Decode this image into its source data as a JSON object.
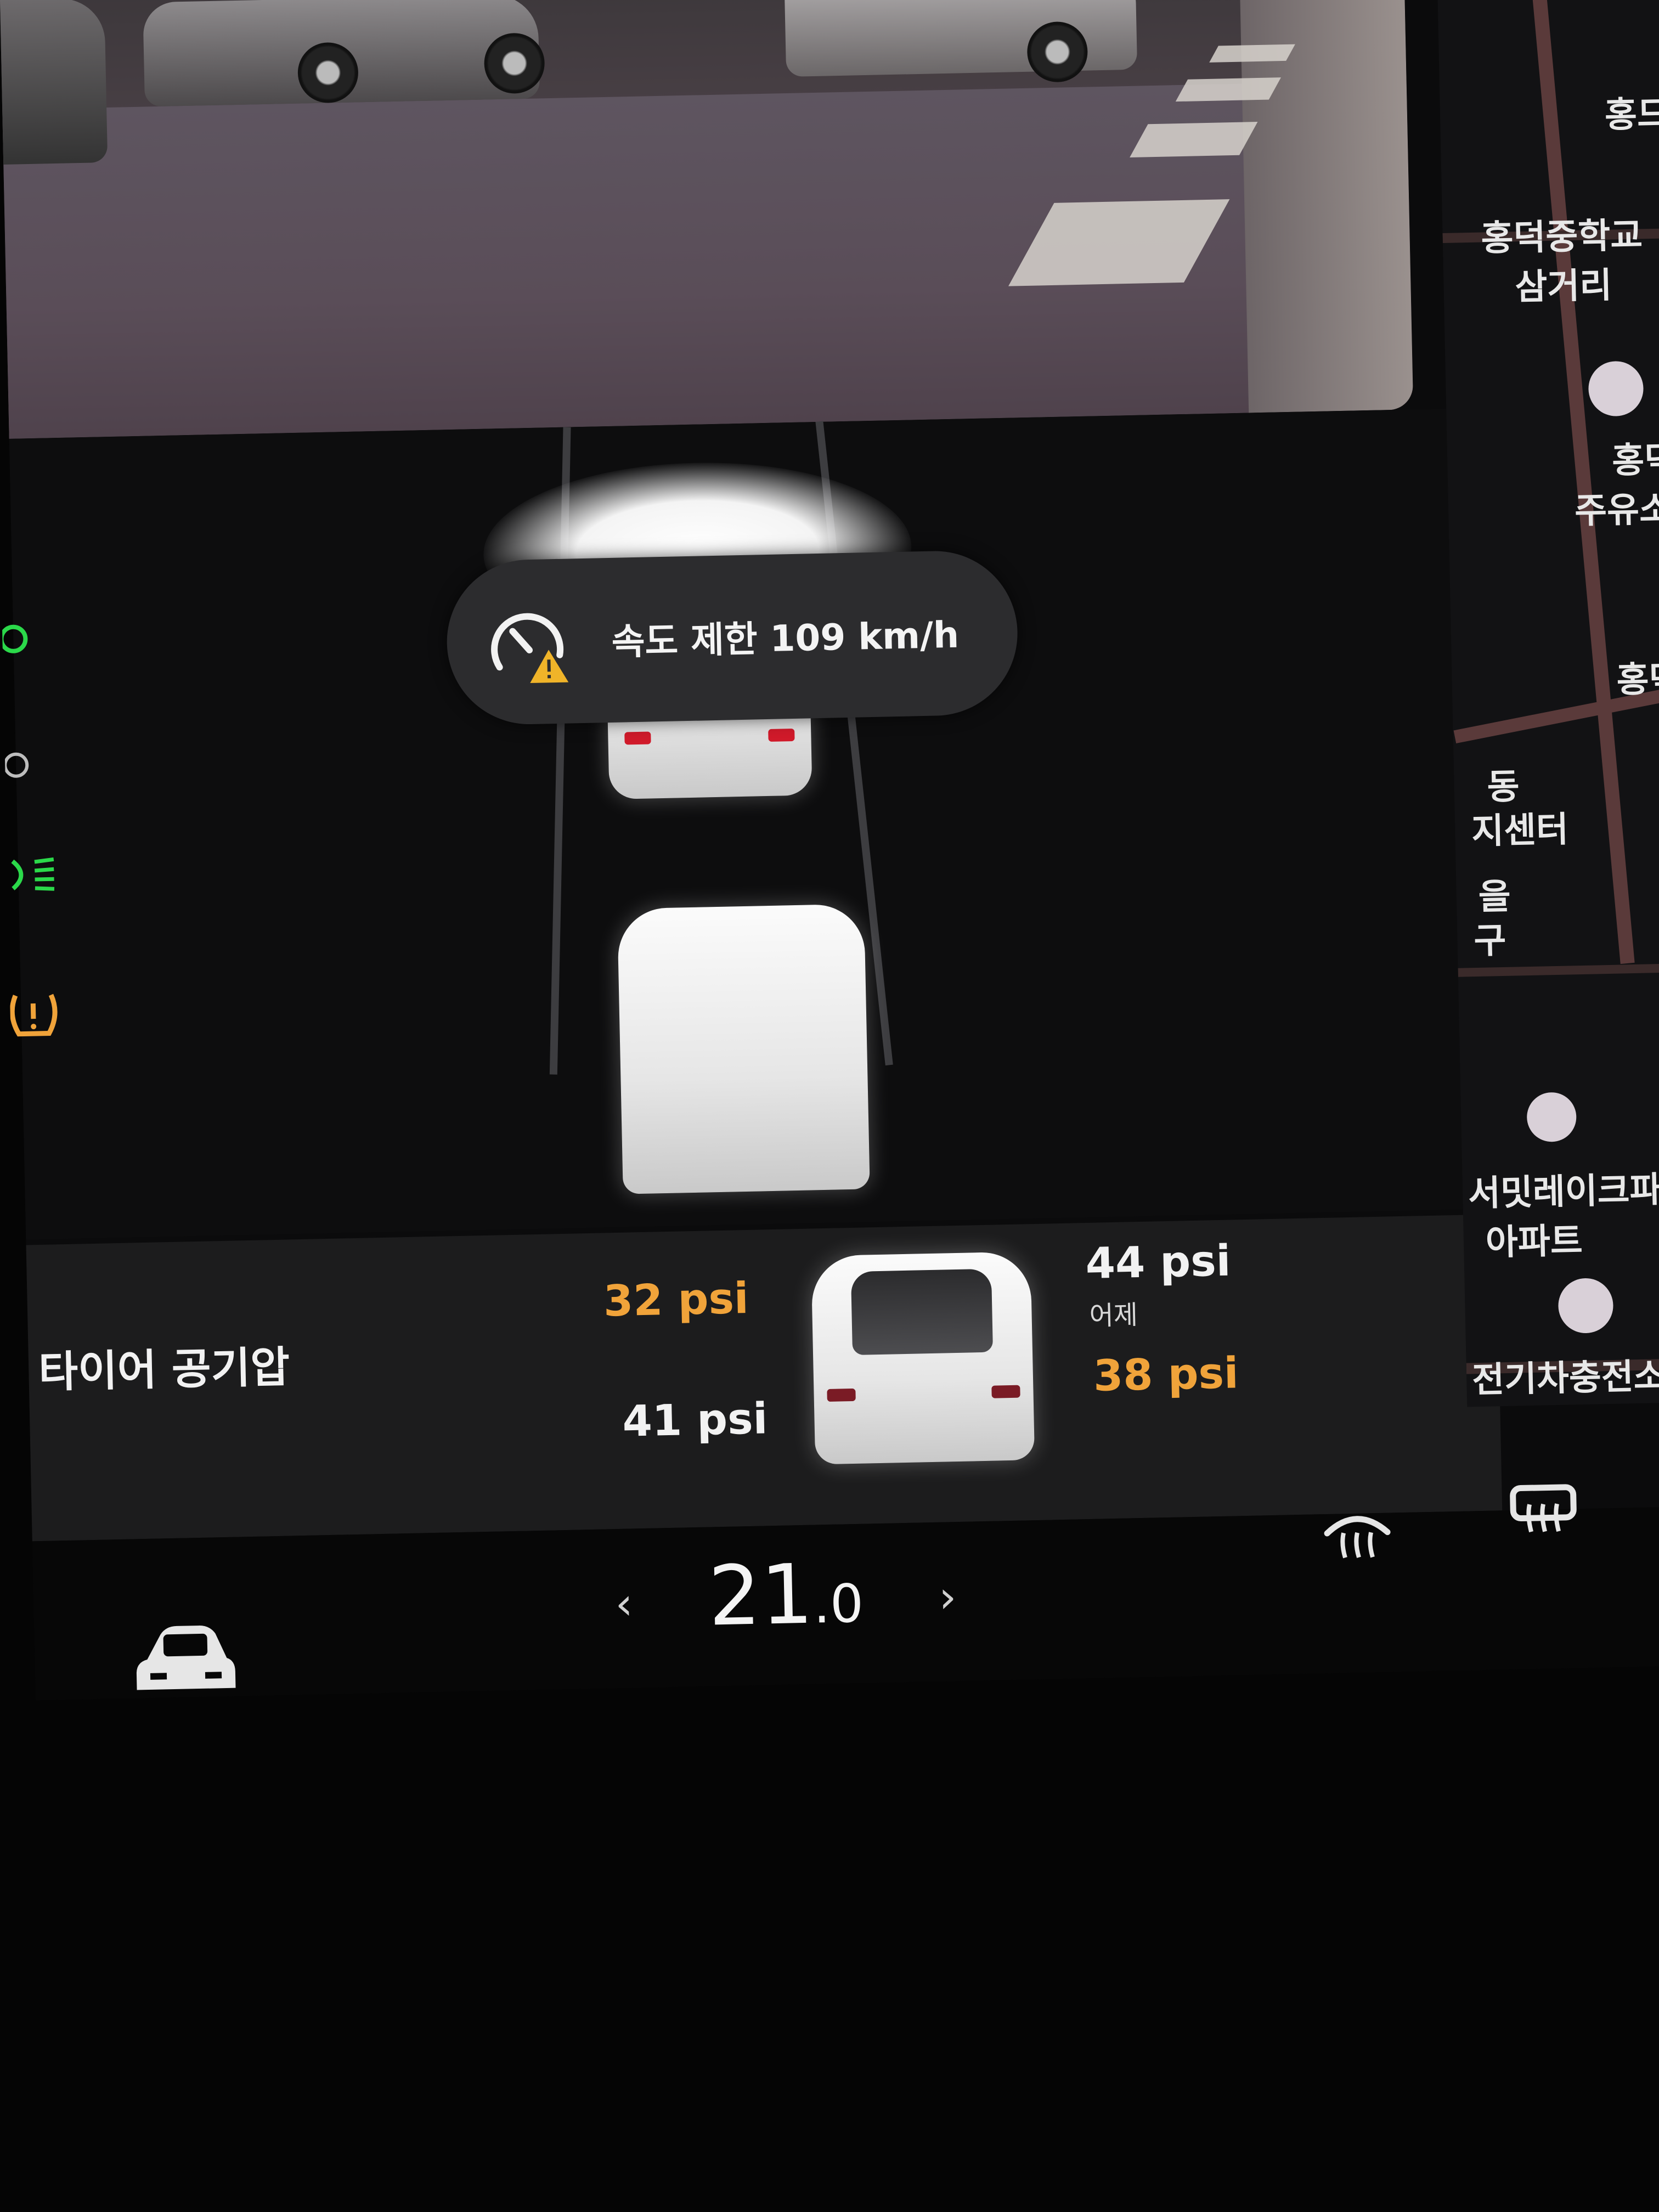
{
  "speed_toast": {
    "label": "속도 제한 109 km/h"
  },
  "tire_pressure": {
    "title": "타이어 공기압",
    "front_left": "32 psi",
    "front_right": "44 psi",
    "front_right_note": "어제",
    "rear_left": "41 psi",
    "rear_right": "38 psi",
    "warn_color": "#f0a33a"
  },
  "climate": {
    "temperature_whole": "21",
    "temperature_decimal": ".0",
    "left_chevron": "‹",
    "right_chevron": "›"
  },
  "map": {
    "labels": [
      "홍드",
      "홍덕중학교",
      "삼거리",
      "홍덕",
      "주유소",
      "홍덕",
      "동",
      "지센터",
      "을",
      "구",
      "서밋레이크파",
      "아파트",
      "전기차충전소"
    ]
  },
  "icons": [
    "headlight-icon",
    "tire-pressure-warning-icon",
    "speed-limit-warning-icon",
    "car-icon",
    "front-defrost-icon",
    "rear-defrost-icon",
    "fuel-station-icon",
    "charging-station-icon"
  ]
}
